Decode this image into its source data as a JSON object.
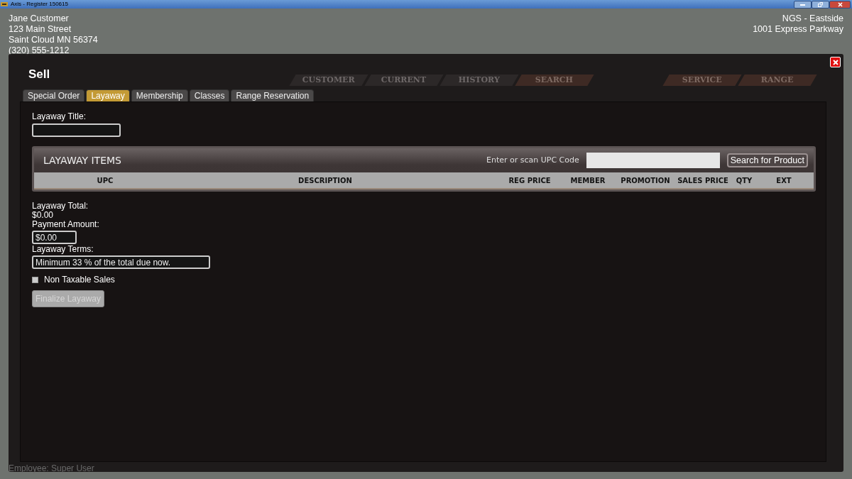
{
  "window": {
    "title": "Axis - Register  150615"
  },
  "customer_lines": [
    "Jane Customer",
    "123 Main Street",
    "Saint Cloud MN 56374",
    "(320) 555-1212"
  ],
  "store_lines": [
    "NGS - Eastside",
    "1001 Express Parkway"
  ],
  "nav_left": [
    {
      "label": "CUSTOMER",
      "highlighted": false
    },
    {
      "label": "CURRENT",
      "highlighted": false
    },
    {
      "label": "HISTORY",
      "highlighted": false
    },
    {
      "label": "SEARCH",
      "highlighted": true
    }
  ],
  "nav_right": [
    {
      "label": "SERVICE",
      "highlighted": true
    },
    {
      "label": "RANGE",
      "highlighted": true
    }
  ],
  "employee": "Employee: Super User",
  "dialog": {
    "title": "Sell",
    "tabs": [
      {
        "label": "Special Order",
        "selected": false
      },
      {
        "label": "Layaway",
        "selected": true
      },
      {
        "label": "Membership",
        "selected": false
      },
      {
        "label": "Classes",
        "selected": false
      },
      {
        "label": "Range Reservation",
        "selected": false
      }
    ],
    "layaway_title": {
      "label": "Layaway Title:"
    },
    "items_panel": {
      "title": "LAYAWAY ITEMS",
      "upc_label": "Enter or scan UPC Code",
      "search_button": "Search for Product",
      "columns": [
        "UPC",
        "DESCRIPTION",
        "REG PRICE",
        "MEMBER",
        "PROMOTION",
        "SALES PRICE",
        "QTY",
        "EXT"
      ]
    },
    "total": {
      "label": "Layaway Total:",
      "value": "$0.00"
    },
    "payment": {
      "label": "Payment Amount:",
      "value": "$0.00"
    },
    "terms": {
      "label": "Layaway Terms:",
      "value": "Minimum 33 % of the total due now."
    },
    "non_taxable": {
      "label": "Non Taxable Sales",
      "checked": false
    },
    "finalize": {
      "label": "Finalize Layaway",
      "disabled": true
    }
  }
}
